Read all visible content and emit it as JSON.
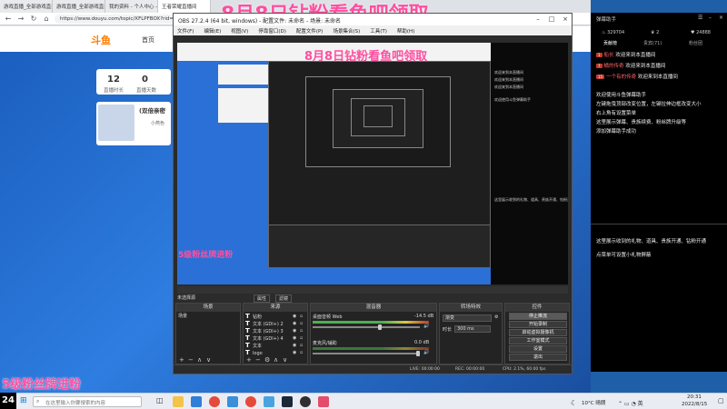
{
  "overlay": {
    "title": "8月8日钻粉看鱼吧领取",
    "title_small": "8月8日钻粉看鱼吧领取",
    "fan_banner": "5级粉丝牌进粉",
    "mini_banner": "5级粉丝牌进粉"
  },
  "browser": {
    "tabs": [
      "游戏直播_全部游戏直播_斗鱼直播",
      "游戏直播_全部游戏直播_斗鱼直播",
      "我的资料 - 个人中心 - 斗鱼",
      "王者荣耀直播间"
    ],
    "url": "https://www.douyu.com/topic/XFLPFBOX?rid=10",
    "logo": "斗鱼",
    "home": "首页",
    "stats": [
      {
        "num": "12",
        "label": "直播时长"
      },
      {
        "num": "0",
        "label": "直播天数"
      }
    ],
    "streamer_name": "(双倍亲密",
    "streamer_sub": "小燕色"
  },
  "obs": {
    "title": "OBS 27.2.4 (64 bit, windows) - 配置文件: 未命名 - 场景: 未命名",
    "menu": [
      "文件(F)",
      "编辑(E)",
      "视图(V)",
      "停靠窗口(D)",
      "配置文件(P)",
      "场景集合(S)",
      "工具(T)",
      "帮助(H)"
    ],
    "no_source": "未选择源",
    "props_btn": "属性",
    "filter_btn": "滤镜",
    "docks": {
      "scenes": "场景",
      "sources": "来源",
      "mixer": "混音器",
      "transitions": "转场特效",
      "controls": "控件"
    },
    "scene_item": "场景",
    "sources": [
      {
        "type": "T",
        "name": "钻粉"
      },
      {
        "type": "T",
        "name": "文本 (GDI+) 2"
      },
      {
        "type": "T",
        "name": "文本 (GDI+) 3"
      },
      {
        "type": "T",
        "name": "文本 (GDI+) 4"
      },
      {
        "type": "T",
        "name": "文本"
      },
      {
        "type": "T",
        "name": "logo"
      }
    ],
    "mixer": [
      {
        "name": "桌面音频 Web",
        "db": "-14.5 dB"
      },
      {
        "name": "麦克风/辅助",
        "db": "0.0 dB"
      }
    ],
    "transition": {
      "type": "渐变",
      "duration_label": "时长",
      "duration": "300 ms"
    },
    "controls": [
      "停止推流",
      "开始录制",
      "启动虚拟摄像机",
      "工作室模式",
      "设置",
      "退出"
    ],
    "status": {
      "live": "LIVE: 00:00:00",
      "rec": "REC: 00:00:00",
      "cpu": "CPU: 2.1%, 60.00 fps"
    }
  },
  "chat": {
    "title": "弹幕助手",
    "stats": [
      "329704",
      "2",
      "24888"
    ],
    "tabs": [
      "贡献榜",
      "贵宾(71)",
      "粉丝团"
    ],
    "enter_rows": [
      {
        "badge": "1",
        "user": "船长",
        "msg": "欢迎来到本直播间"
      },
      {
        "badge": "7",
        "user": "橘的传奇",
        "msg": "欢迎来到本直播间"
      },
      {
        "badge": "15",
        "user": "一个有的传奇",
        "msg": "欢迎来到本直播间"
      }
    ],
    "messages": [
      "欢迎使用斗鱼弹幕助手",
      "左键拖曳顶部改变位置，左键拉伸边框改变大小",
      "右上角有设置菜单",
      "这里展示弹幕、贵族续费、粉丝牌升级等",
      "添加弹幕助手成功"
    ],
    "lower_messages": [
      "这里展示收到的礼物、道具、贵族开通、钻粉开通",
      "点菜单可设置小礼物屏蔽"
    ]
  },
  "taskbar": {
    "search_placeholder": "在这里输入你要搜索的内容",
    "weather": "10°C 晴朗",
    "time": "20:31",
    "date": "2022/8/15",
    "badge": "24"
  }
}
